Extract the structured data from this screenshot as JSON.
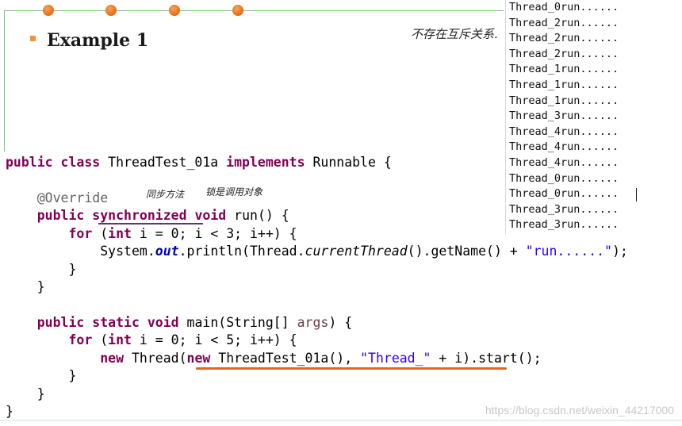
{
  "slide": {
    "title": "Example 1",
    "handwritten_note_right": "不存在互斥关系.",
    "handwritten_note_sync": "同步方法",
    "handwritten_note_lock": "锁是调用对象"
  },
  "console_output": [
    "Thread_0run......",
    "Thread_2run......",
    "Thread_2run......",
    "Thread_2run......",
    "Thread_1run......",
    "Thread_1run......",
    "Thread_1run......",
    "Thread_3run......",
    "Thread_4run......",
    "Thread_4run......",
    "Thread_4run......",
    "Thread_0run......",
    "Thread_0run......",
    "Thread_3run......",
    "Thread_3run......"
  ],
  "code": {
    "l1": {
      "kw1": "public",
      "kw2": "class",
      "name": "ThreadTest_01a",
      "kw3": "implements",
      "rest": "Runnable {"
    },
    "l3": {
      "annotation": "@Override"
    },
    "l4": {
      "kw1": "public",
      "kw2": "synchronized",
      "kw3": "void",
      "rest": "run() {"
    },
    "l5": {
      "kw1": "for",
      "open": "(",
      "kw2": "int",
      "rest": "i = 0; i < 3; i++) {"
    },
    "l6": {
      "pre": "System.",
      "field": "out",
      "mid": ".println(Thread.",
      "method": "currentThread",
      "post": "().getName() + ",
      "str": "\"run......\"",
      "end": ");"
    },
    "l7": {
      "text": "}"
    },
    "l8": {
      "text": "}"
    },
    "l10": {
      "kw1": "public",
      "kw2": "static",
      "kw3": "void",
      "pre": "main(String[] ",
      "var": "args",
      "post": ") {"
    },
    "l11": {
      "kw1": "for",
      "open": "(",
      "kw2": "int",
      "rest": "i = 0; i < 5; i++) {"
    },
    "l12": {
      "kw1": "new",
      "pre": "Thread(",
      "kw2": "new",
      "mid": "ThreadTest_01a(), ",
      "str": "\"Thread_\"",
      "post": " + i).start();"
    },
    "l13": {
      "text": "}"
    },
    "l14": {
      "text": "}"
    },
    "l15": {
      "text": "}"
    }
  },
  "watermark": "https://blog.csdn.net/weixin_44217000",
  "colors": {
    "keyword": "#7f0055",
    "string": "#2a00ff",
    "accent_orange": "#e8641c",
    "frame_green": "#7cc576"
  }
}
